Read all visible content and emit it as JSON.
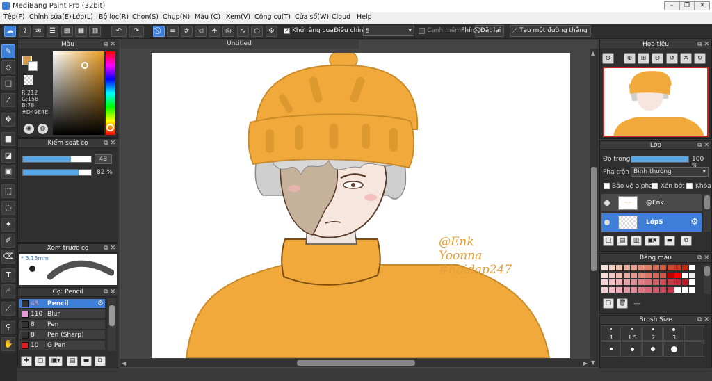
{
  "window": {
    "title": "MediBang Paint Pro (32bit)"
  },
  "menu": [
    "Tệp(F)",
    "Chỉnh sửa(E)",
    "Lớp(L)",
    "Bộ lọc(R)",
    "Chọn(S)",
    "Chụp(N)",
    "Màu (C)",
    "Xem(V)",
    "Công cụ(T)",
    "Cửa sổ(W)",
    "Cloud",
    "Help"
  ],
  "toolbar": {
    "antialias_label": "Khử răng cưa",
    "adjust_label": "Điều chỉnh",
    "adjust_value": "5",
    "edge_label": "Cạnh mềm",
    "keyboard_label": "Phím",
    "reset_label": "Đặt lại",
    "straight_line_label": "Tạo một đường thẳng"
  },
  "color_panel": {
    "title": "Màu",
    "r": "R:212",
    "g": "G:158",
    "b": "B:78",
    "hex": "#D49E4E",
    "primary_color": "#D49E4E"
  },
  "brush_control": {
    "title": "Kiểm soát cọ",
    "size_value": "43",
    "opacity_value": "82 %",
    "size_fill": 0.7,
    "opacity_fill": 0.82
  },
  "brush_preview": {
    "title": "Xem trước cọ",
    "size_label": "* 3.13mm"
  },
  "brush_list": {
    "title": "Cọ: Pencil",
    "items": [
      {
        "size": "43",
        "name": "Pencil",
        "color": "#333333",
        "selected": true
      },
      {
        "size": "110",
        "name": "Blur",
        "color": "#e89ad6",
        "selected": false
      },
      {
        "size": "8",
        "name": "Pen",
        "color": "#333333",
        "selected": false
      },
      {
        "size": "8",
        "name": "Pen (Sharp)",
        "color": "#333333",
        "selected": false
      },
      {
        "size": "10",
        "name": "G Pen",
        "color": "#e02020",
        "selected": false
      }
    ]
  },
  "canvas": {
    "tab_title": "Untitled",
    "watermark_line1": "@Enk",
    "watermark_line2": "Yoonna",
    "watermark_line3": "#hoidap247"
  },
  "navigator": {
    "title": "Hoa tiêu"
  },
  "layer_panel": {
    "title": "Lớp",
    "opacity_label": "Độ trong",
    "opacity_value": "100 %",
    "opacity_fill": 1.0,
    "blend_label": "Pha trộn",
    "blend_value": "Bình thường",
    "protect_alpha": "Bảo vệ alpha",
    "clipping": "Xén bớt",
    "lock": "Khóa",
    "layers": [
      {
        "name": "@Enk",
        "selected": false
      },
      {
        "name": "Lớp5",
        "selected": true
      }
    ]
  },
  "palette_panel": {
    "title": "Bảng màu",
    "footer_label": "---",
    "colors": [
      "#f8e3dc",
      "#f4d3c8",
      "#f0c2b3",
      "#ebb1a0",
      "#e6a08d",
      "#e18f7a",
      "#dc7e68",
      "#d76d56",
      "#d25c44",
      "#cd4b33",
      "#c83a22",
      "#c32911",
      "#ffffff",
      "#f7dcd8",
      "#f3cbc6",
      "#eebab4",
      "#e9a9a2",
      "#e59890",
      "#e0877e",
      "#db766c",
      "#d6655a",
      "#d15448",
      "#c00000",
      "#ff0000",
      "#ffffff",
      "#eeeeee",
      "#f6d5d8",
      "#f2c4c8",
      "#edb3b8",
      "#e8a2a8",
      "#e39198",
      "#de8088",
      "#d96f78",
      "#d45e68",
      "#cf4d58",
      "#ca3c48",
      "#c52b38",
      "#c01a28",
      "#ffffff",
      "#f5ced8",
      "#f1bdc8",
      "#ecacb8",
      "#e79ba8",
      "#e28a98",
      "#dd7988",
      "#d86878",
      "#d35768",
      "#ce4658",
      "#c93548",
      "#ffffff",
      "#ffffff",
      "#ffffff"
    ]
  },
  "brush_size_panel": {
    "title": "Brush Size",
    "sizes": [
      "1",
      "1.5",
      "2",
      "3"
    ]
  }
}
